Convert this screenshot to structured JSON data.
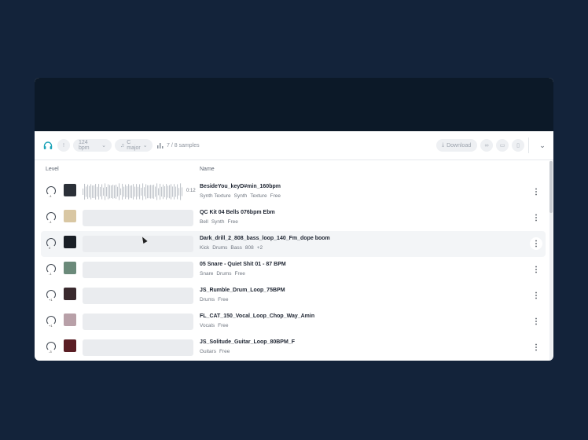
{
  "toolbar": {
    "bpm": "124 bpm",
    "key": "C major",
    "samples": "7 / 8 samples",
    "download": "Download"
  },
  "columns": {
    "level": "Level",
    "name": "Name"
  },
  "rows": [
    {
      "title": "BesideYou_keyD#min_160bpm",
      "tags": [
        "Synth Texture",
        "Synth",
        "Texture",
        "Free"
      ],
      "level": "-1",
      "duration": "0:12",
      "art": "#2b3038"
    },
    {
      "title": "QC Kit 04 Bells 076bpm Ebm",
      "tags": [
        "Bell",
        "Synth",
        "Free"
      ],
      "level": "-1",
      "duration": "",
      "art": "#d9c7a3"
    },
    {
      "title": "Dark_drill_2_808_bass_loop_140_Fm_dope boom",
      "tags": [
        "Kick",
        "Drums",
        "Bass",
        "808",
        "+2"
      ],
      "level": "0",
      "duration": "",
      "art": "#1a1f26"
    },
    {
      "title": "05 Snare - Quiet Shit 01 - 87 BPM",
      "tags": [
        "Snare",
        "Drums",
        "Free"
      ],
      "level": "-1",
      "duration": "",
      "art": "#6b8a7a"
    },
    {
      "title": "JS_Rumble_Drum_Loop_75BPM",
      "tags": [
        "Drums",
        "Free"
      ],
      "level": "+1",
      "duration": "",
      "art": "#3a2a2e"
    },
    {
      "title": "FL_CAT_150_Vocal_Loop_Chop_Way_Amin",
      "tags": [
        "Vocals",
        "Free"
      ],
      "level": "+1",
      "duration": "",
      "art": "#b8a0a8"
    },
    {
      "title": "JS_Solitude_Guitar_Loop_80BPM_F",
      "tags": [
        "Guitars",
        "Free"
      ],
      "level": "-3",
      "duration": "",
      "art": "#5a1e24"
    }
  ]
}
